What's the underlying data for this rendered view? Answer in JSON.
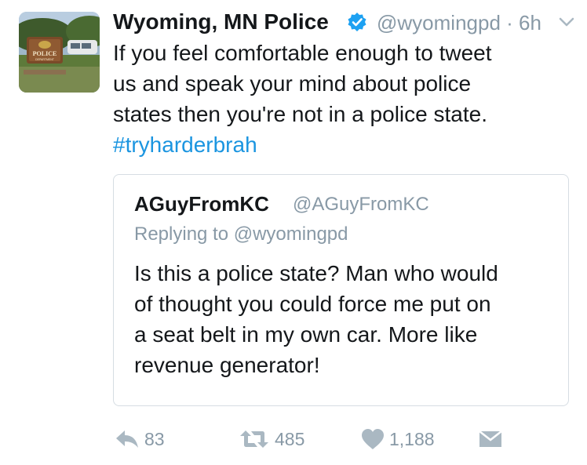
{
  "tweet": {
    "author_name": "Wyoming, MN Police",
    "handle": "@wyomingpd",
    "separator": "·",
    "time": "6h",
    "text_lines": [
      "If you feel comfortable enough to tweet",
      "us and speak your mind about police",
      "states then you're not in a police state."
    ],
    "hashtag": "#tryharderbrah",
    "avatar": {
      "sign_text": "POLICE",
      "sign_subtext": "DEPARTMENT"
    },
    "icons": {
      "verified": "verified-badge-icon",
      "menu": "chevron-down-icon"
    }
  },
  "quoted": {
    "author_name": "AGuyFromKC",
    "handle": "@AGuyFromKC",
    "replying_to": "Replying to @wyomingpd",
    "text_lines": [
      "Is this a police state? Man who would",
      "of thought you could force me put on",
      "a seat belt in my own car. More like",
      "revenue generator!"
    ]
  },
  "actions": {
    "reply_count": "83",
    "retweet_count": "485",
    "like_count": "1,188",
    "icons": [
      "reply-icon",
      "retweet-icon",
      "like-icon",
      "direct-message-icon"
    ]
  },
  "colors": {
    "link": "#1b95e0",
    "secondary": "#8899a6",
    "text": "#14171a",
    "border": "#d6dde3"
  }
}
